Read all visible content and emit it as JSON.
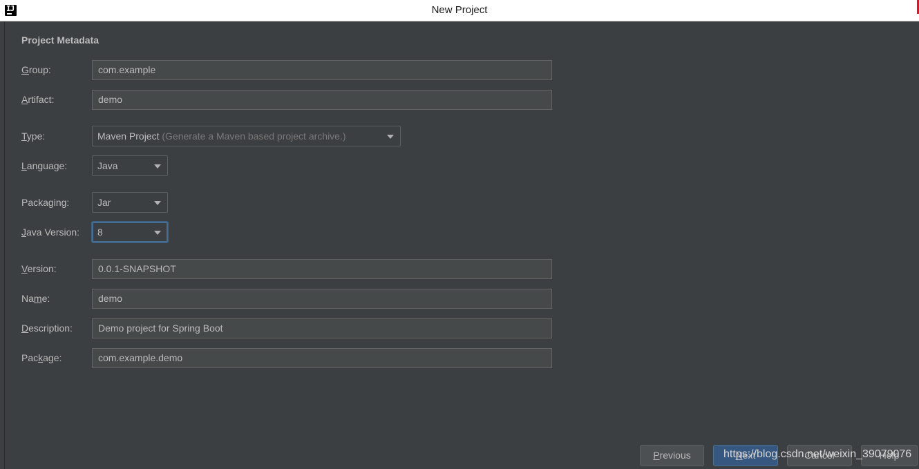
{
  "window": {
    "title": "New Project",
    "app_icon": "intellij-icon",
    "app_icon_glyph": "IJ"
  },
  "section": {
    "title": "Project Metadata"
  },
  "fields": {
    "group": {
      "label_mnemonic": "G",
      "label_rest": "roup:",
      "value": "com.example"
    },
    "artifact": {
      "label_mnemonic": "A",
      "label_rest": "rtifact:",
      "value": "demo"
    },
    "type": {
      "label_mnemonic": "T",
      "label_rest": "ype:",
      "value": "Maven Project",
      "hint": "(Generate a Maven based project archive.)"
    },
    "language": {
      "label_pre": "",
      "label_mnemonic": "L",
      "label_rest": "anguage:",
      "value": "Java"
    },
    "packaging": {
      "label_pre": "Packa",
      "label_mnemonic": "g",
      "label_rest": "ing:",
      "value": "Jar"
    },
    "java_version": {
      "label_mnemonic": "J",
      "label_rest": "ava Version:",
      "value": "8"
    },
    "version": {
      "label_mnemonic": "V",
      "label_rest": "ersion:",
      "value": "0.0.1-SNAPSHOT"
    },
    "name": {
      "label_pre": "Na",
      "label_mnemonic": "m",
      "label_rest": "e:",
      "value": "demo"
    },
    "description": {
      "label_mnemonic": "D",
      "label_rest": "escription:",
      "value": "Demo project for Spring Boot"
    },
    "package": {
      "label_pre": "Pac",
      "label_mnemonic": "k",
      "label_rest": "age:",
      "value": "com.example.demo"
    }
  },
  "buttons": {
    "previous": {
      "mnemonic": "P",
      "rest": "revious"
    },
    "next": {
      "mnemonic": "N",
      "rest": "ext"
    },
    "cancel": {
      "label": "Cancel"
    },
    "help": {
      "label": "Help"
    }
  },
  "watermark": "https://blog.csdn.net/weixin_39079076",
  "colors": {
    "background": "#3c3f41",
    "input_background": "#45494a",
    "text": "#bbbbbb",
    "hint_text": "#787878",
    "focus_border": "#466d94",
    "primary_button": "#365880"
  }
}
